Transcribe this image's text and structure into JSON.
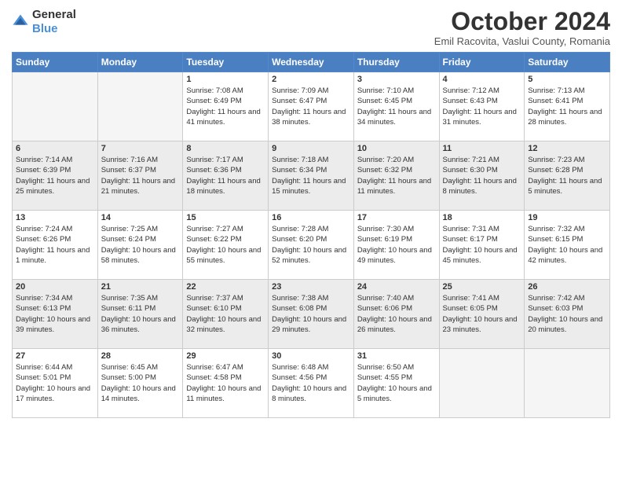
{
  "header": {
    "logo_general": "General",
    "logo_blue": "Blue",
    "month_title": "October 2024",
    "location": "Emil Racovita, Vaslui County, Romania"
  },
  "weekdays": [
    "Sunday",
    "Monday",
    "Tuesday",
    "Wednesday",
    "Thursday",
    "Friday",
    "Saturday"
  ],
  "weeks": [
    [
      {
        "day": "",
        "sunrise": "",
        "sunset": "",
        "daylight": ""
      },
      {
        "day": "",
        "sunrise": "",
        "sunset": "",
        "daylight": ""
      },
      {
        "day": "1",
        "sunrise": "Sunrise: 7:08 AM",
        "sunset": "Sunset: 6:49 PM",
        "daylight": "Daylight: 11 hours and 41 minutes."
      },
      {
        "day": "2",
        "sunrise": "Sunrise: 7:09 AM",
        "sunset": "Sunset: 6:47 PM",
        "daylight": "Daylight: 11 hours and 38 minutes."
      },
      {
        "day": "3",
        "sunrise": "Sunrise: 7:10 AM",
        "sunset": "Sunset: 6:45 PM",
        "daylight": "Daylight: 11 hours and 34 minutes."
      },
      {
        "day": "4",
        "sunrise": "Sunrise: 7:12 AM",
        "sunset": "Sunset: 6:43 PM",
        "daylight": "Daylight: 11 hours and 31 minutes."
      },
      {
        "day": "5",
        "sunrise": "Sunrise: 7:13 AM",
        "sunset": "Sunset: 6:41 PM",
        "daylight": "Daylight: 11 hours and 28 minutes."
      }
    ],
    [
      {
        "day": "6",
        "sunrise": "Sunrise: 7:14 AM",
        "sunset": "Sunset: 6:39 PM",
        "daylight": "Daylight: 11 hours and 25 minutes."
      },
      {
        "day": "7",
        "sunrise": "Sunrise: 7:16 AM",
        "sunset": "Sunset: 6:37 PM",
        "daylight": "Daylight: 11 hours and 21 minutes."
      },
      {
        "day": "8",
        "sunrise": "Sunrise: 7:17 AM",
        "sunset": "Sunset: 6:36 PM",
        "daylight": "Daylight: 11 hours and 18 minutes."
      },
      {
        "day": "9",
        "sunrise": "Sunrise: 7:18 AM",
        "sunset": "Sunset: 6:34 PM",
        "daylight": "Daylight: 11 hours and 15 minutes."
      },
      {
        "day": "10",
        "sunrise": "Sunrise: 7:20 AM",
        "sunset": "Sunset: 6:32 PM",
        "daylight": "Daylight: 11 hours and 11 minutes."
      },
      {
        "day": "11",
        "sunrise": "Sunrise: 7:21 AM",
        "sunset": "Sunset: 6:30 PM",
        "daylight": "Daylight: 11 hours and 8 minutes."
      },
      {
        "day": "12",
        "sunrise": "Sunrise: 7:23 AM",
        "sunset": "Sunset: 6:28 PM",
        "daylight": "Daylight: 11 hours and 5 minutes."
      }
    ],
    [
      {
        "day": "13",
        "sunrise": "Sunrise: 7:24 AM",
        "sunset": "Sunset: 6:26 PM",
        "daylight": "Daylight: 11 hours and 1 minute."
      },
      {
        "day": "14",
        "sunrise": "Sunrise: 7:25 AM",
        "sunset": "Sunset: 6:24 PM",
        "daylight": "Daylight: 10 hours and 58 minutes."
      },
      {
        "day": "15",
        "sunrise": "Sunrise: 7:27 AM",
        "sunset": "Sunset: 6:22 PM",
        "daylight": "Daylight: 10 hours and 55 minutes."
      },
      {
        "day": "16",
        "sunrise": "Sunrise: 7:28 AM",
        "sunset": "Sunset: 6:20 PM",
        "daylight": "Daylight: 10 hours and 52 minutes."
      },
      {
        "day": "17",
        "sunrise": "Sunrise: 7:30 AM",
        "sunset": "Sunset: 6:19 PM",
        "daylight": "Daylight: 10 hours and 49 minutes."
      },
      {
        "day": "18",
        "sunrise": "Sunrise: 7:31 AM",
        "sunset": "Sunset: 6:17 PM",
        "daylight": "Daylight: 10 hours and 45 minutes."
      },
      {
        "day": "19",
        "sunrise": "Sunrise: 7:32 AM",
        "sunset": "Sunset: 6:15 PM",
        "daylight": "Daylight: 10 hours and 42 minutes."
      }
    ],
    [
      {
        "day": "20",
        "sunrise": "Sunrise: 7:34 AM",
        "sunset": "Sunset: 6:13 PM",
        "daylight": "Daylight: 10 hours and 39 minutes."
      },
      {
        "day": "21",
        "sunrise": "Sunrise: 7:35 AM",
        "sunset": "Sunset: 6:11 PM",
        "daylight": "Daylight: 10 hours and 36 minutes."
      },
      {
        "day": "22",
        "sunrise": "Sunrise: 7:37 AM",
        "sunset": "Sunset: 6:10 PM",
        "daylight": "Daylight: 10 hours and 32 minutes."
      },
      {
        "day": "23",
        "sunrise": "Sunrise: 7:38 AM",
        "sunset": "Sunset: 6:08 PM",
        "daylight": "Daylight: 10 hours and 29 minutes."
      },
      {
        "day": "24",
        "sunrise": "Sunrise: 7:40 AM",
        "sunset": "Sunset: 6:06 PM",
        "daylight": "Daylight: 10 hours and 26 minutes."
      },
      {
        "day": "25",
        "sunrise": "Sunrise: 7:41 AM",
        "sunset": "Sunset: 6:05 PM",
        "daylight": "Daylight: 10 hours and 23 minutes."
      },
      {
        "day": "26",
        "sunrise": "Sunrise: 7:42 AM",
        "sunset": "Sunset: 6:03 PM",
        "daylight": "Daylight: 10 hours and 20 minutes."
      }
    ],
    [
      {
        "day": "27",
        "sunrise": "Sunrise: 6:44 AM",
        "sunset": "Sunset: 5:01 PM",
        "daylight": "Daylight: 10 hours and 17 minutes."
      },
      {
        "day": "28",
        "sunrise": "Sunrise: 6:45 AM",
        "sunset": "Sunset: 5:00 PM",
        "daylight": "Daylight: 10 hours and 14 minutes."
      },
      {
        "day": "29",
        "sunrise": "Sunrise: 6:47 AM",
        "sunset": "Sunset: 4:58 PM",
        "daylight": "Daylight: 10 hours and 11 minutes."
      },
      {
        "day": "30",
        "sunrise": "Sunrise: 6:48 AM",
        "sunset": "Sunset: 4:56 PM",
        "daylight": "Daylight: 10 hours and 8 minutes."
      },
      {
        "day": "31",
        "sunrise": "Sunrise: 6:50 AM",
        "sunset": "Sunset: 4:55 PM",
        "daylight": "Daylight: 10 hours and 5 minutes."
      },
      {
        "day": "",
        "sunrise": "",
        "sunset": "",
        "daylight": ""
      },
      {
        "day": "",
        "sunrise": "",
        "sunset": "",
        "daylight": ""
      }
    ]
  ]
}
